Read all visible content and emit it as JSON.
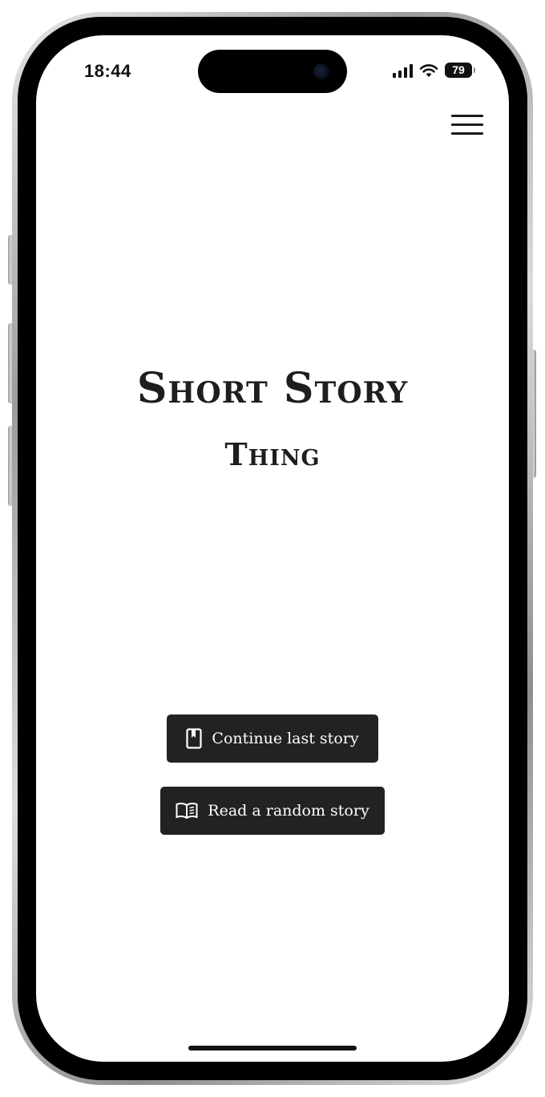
{
  "status_bar": {
    "time": "18:44",
    "battery_level": "79",
    "icons": [
      "cellular-signal-icon",
      "wifi-icon",
      "battery-icon"
    ]
  },
  "header": {
    "menu_icon": "hamburger-menu-icon"
  },
  "hero": {
    "title": "Short Story",
    "subtitle": "Thing"
  },
  "actions": {
    "continue_label": "Continue last story",
    "continue_icon": "bookmark-icon",
    "random_label": "Read a random story",
    "random_icon": "open-book-icon"
  },
  "colors": {
    "background": "#ffffff",
    "text": "#1e1e1e",
    "button_background": "#222222",
    "button_text": "#ffffff"
  }
}
